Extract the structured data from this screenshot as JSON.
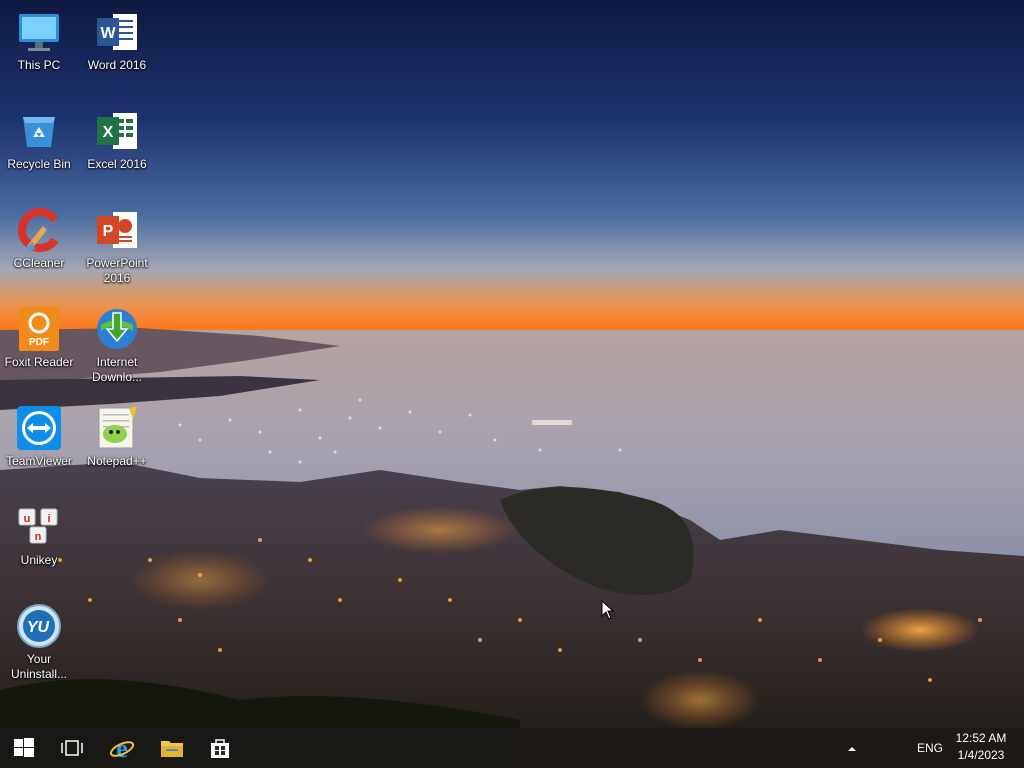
{
  "desktop": {
    "icons": [
      {
        "label": "This PC",
        "icon": "computer-icon"
      },
      {
        "label": "Word 2016",
        "icon": "word-icon"
      },
      {
        "label": "Recycle Bin",
        "icon": "recycle-bin-icon"
      },
      {
        "label": "Excel 2016",
        "icon": "excel-icon"
      },
      {
        "label": "CCleaner",
        "icon": "ccleaner-icon"
      },
      {
        "label": "PowerPoint 2016",
        "icon": "powerpoint-icon"
      },
      {
        "label": "Foxit Reader",
        "icon": "foxit-pdf-icon"
      },
      {
        "label": "Internet Downlo...",
        "icon": "internet-download-manager-icon"
      },
      {
        "label": "TeamViewer",
        "icon": "teamviewer-icon"
      },
      {
        "label": "Notepad++",
        "icon": "notepad-plus-plus-icon"
      },
      {
        "label": "Unikey",
        "icon": "unikey-icon"
      },
      {
        "label": "Your Uninstall...",
        "icon": "your-uninstaller-icon"
      }
    ]
  },
  "taskbar": {
    "start": {
      "icon": "windows-logo-icon"
    },
    "task_view": {
      "icon": "task-view-icon"
    },
    "pinned": [
      {
        "name": "Internet Explorer",
        "icon": "internet-explorer-icon"
      },
      {
        "name": "File Explorer",
        "icon": "folder-icon"
      },
      {
        "name": "Store",
        "icon": "store-bag-icon"
      }
    ],
    "tray": {
      "chevron_icon": "chevron-up-icon",
      "language": "ENG",
      "time": "12:52 AM",
      "date": "1/4/2023"
    }
  },
  "colors": {
    "sky_top": "#0f1a42",
    "horizon": "#ff8a2a",
    "sea": "#a9a0ab",
    "taskbar": "#1c1816"
  }
}
